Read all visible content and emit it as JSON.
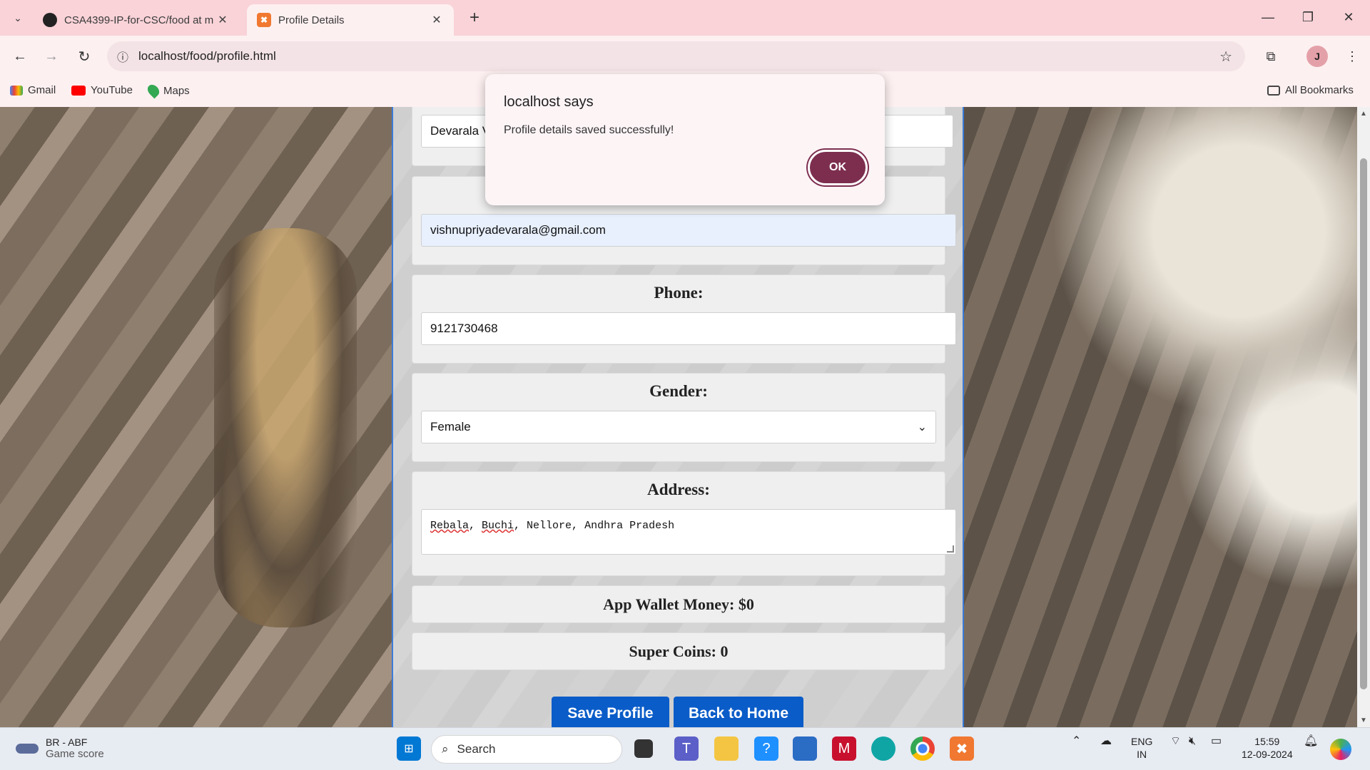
{
  "browser": {
    "tabs": [
      {
        "title": "CSA4399-IP-for-CSC/food at m",
        "icon": "github-icon"
      },
      {
        "title": "Profile Details",
        "icon": "xampp-icon"
      }
    ],
    "url": "localhost/food/profile.html",
    "bookmarks": [
      "Gmail",
      "YouTube",
      "Maps"
    ],
    "all_bookmarks": "All Bookmarks"
  },
  "form": {
    "name_value": "Devarala V",
    "email_value": "vishnupriyadevarala@gmail.com",
    "phone_label": "Phone:",
    "phone_value": "9121730468",
    "gender_label": "Gender:",
    "gender_value": "Female",
    "address_label": "Address:",
    "address_value": "Rebala, Buchi, Nellore, Andhra Pradesh",
    "wallet": "App Wallet Money: $0",
    "coins": "Super Coins: 0",
    "save_button": "Save Profile",
    "home_button": "Back to Home"
  },
  "dialog": {
    "title": "localhost says",
    "message": "Profile details saved successfully!",
    "ok": "OK"
  },
  "taskbar": {
    "game_title": "BR - ABF",
    "game_subtitle": "Game score",
    "search": "Search",
    "lang_1": "ENG",
    "lang_2": "IN",
    "time": "15:59",
    "date": "12-09-2024"
  }
}
